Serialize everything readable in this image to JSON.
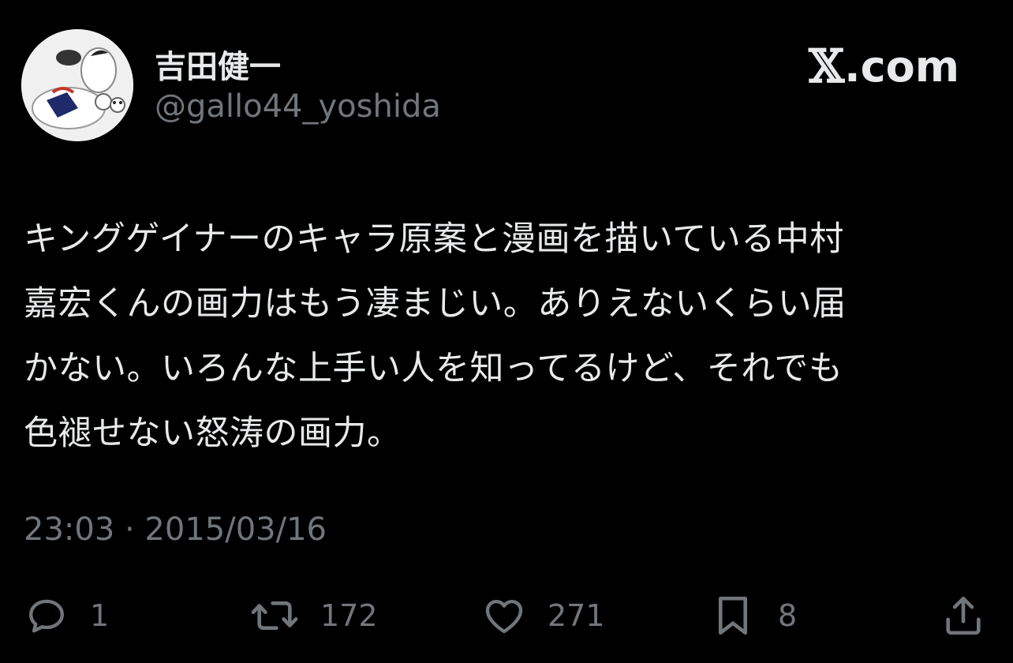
{
  "author": {
    "display_name": "吉田健一",
    "handle": "@gallo44_yoshida",
    "avatar_icon": "avatar-illustration"
  },
  "brand": {
    "label": ".com",
    "logo_icon": "x-logo-icon"
  },
  "post": {
    "lines": [
      "キングゲイナーのキャラ原案と漫画を描いている中村",
      "嘉宏くんの画力はもう凄まじい。ありえないくらい届",
      "かない。いろんな上手い人を知ってるけど、それでも",
      "色褪せない怒涛の画力。"
    ],
    "timestamp": "23:03 · 2015/03/16"
  },
  "actions": {
    "reply": {
      "icon": "reply-icon",
      "count": "1"
    },
    "repost": {
      "icon": "repost-icon",
      "count": "172"
    },
    "like": {
      "icon": "heart-icon",
      "count": "271"
    },
    "bookmark": {
      "icon": "bookmark-icon",
      "count": "8"
    },
    "share": {
      "icon": "share-icon"
    }
  },
  "colors": {
    "background": "#000000",
    "primary_text": "#e7e9ea",
    "secondary_text": "#71767b"
  }
}
